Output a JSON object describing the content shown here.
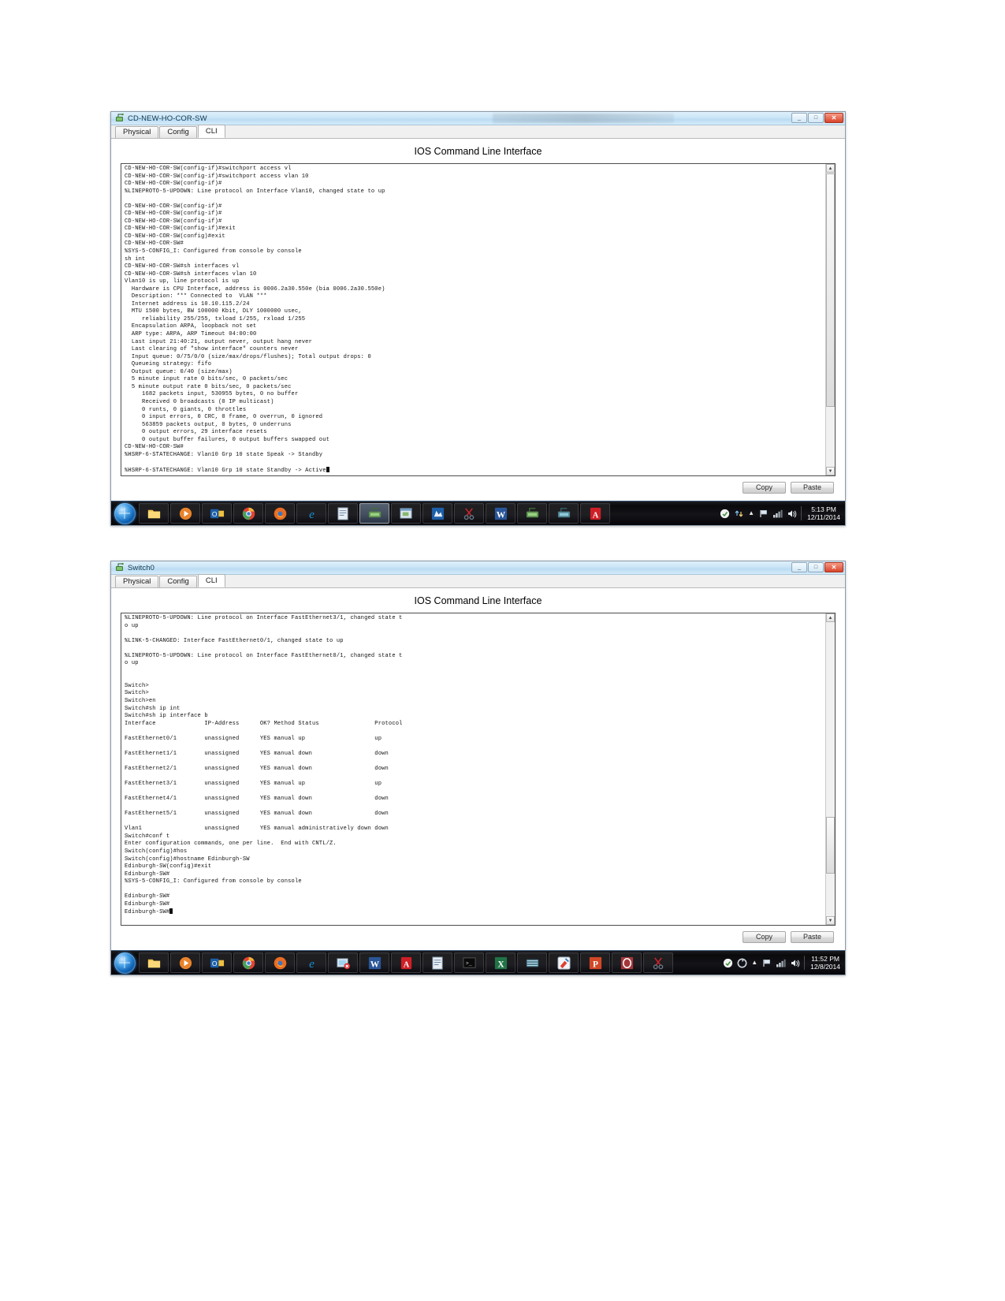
{
  "colors": {
    "titlebar_accent": "#bcdcf3",
    "close_button": "#d8442a",
    "terminal_text": "#121212",
    "taskbar": "#0a0a0c"
  },
  "windows": [
    {
      "title": "CD-NEW-HO-COR-SW",
      "icon": "packet-tracer-device-icon",
      "tabs": [
        {
          "label": "Physical",
          "active": false
        },
        {
          "label": "Config",
          "active": false
        },
        {
          "label": "CLI",
          "active": true
        }
      ],
      "panel_heading": "IOS Command Line Interface",
      "window_buttons": {
        "minimize": "_",
        "maximize": "□",
        "close": "✕"
      },
      "terminal_text": "CD-NEW-HO-COR-SW(config-if)#switchport access vl\nCD-NEW-HO-COR-SW(config-if)#switchport access vlan 10\nCD-NEW-HO-COR-SW(config-if)#\n%LINEPROTO-5-UPDOWN: Line protocol on Interface Vlan10, changed state to up\n\nCD-NEW-HO-COR-SW(config-if)#\nCD-NEW-HO-COR-SW(config-if)#\nCD-NEW-HO-COR-SW(config-if)#\nCD-NEW-HO-COR-SW(config-if)#exit\nCD-NEW-HO-COR-SW(config)#exit\nCD-NEW-HO-COR-SW#\n%SYS-5-CONFIG_I: Configured from console by console\nsh int\nCD-NEW-HO-COR-SW#sh interfaces vl\nCD-NEW-HO-COR-SW#sh interfaces vlan 10\nVlan10 is up, line protocol is up\n  Hardware is CPU Interface, address is 0006.2a30.550e (bia 0006.2a30.550e)\n  Description: *** Connected to  VLAN ***\n  Internet address is 10.10.115.2/24\n  MTU 1500 bytes, BW 100000 Kbit, DLY 1000000 usec,\n     reliability 255/255, txload 1/255, rxload 1/255\n  Encapsulation ARPA, loopback not set\n  ARP type: ARPA, ARP Timeout 04:00:00\n  Last input 21:40:21, output never, output hang never\n  Last clearing of \"show interface\" counters never\n  Input queue: 0/75/0/0 (size/max/drops/flushes); Total output drops: 0\n  Queueing strategy: fifo\n  Output queue: 0/40 (size/max)\n  5 minute input rate 0 bits/sec, 0 packets/sec\n  5 minute output rate 0 bits/sec, 0 packets/sec\n     1682 packets input, 530955 bytes, 0 no buffer\n     Received 0 broadcasts (0 IP multicast)\n     0 runts, 0 giants, 0 throttles\n     0 input errors, 0 CRC, 0 frame, 0 overrun, 0 ignored\n     563859 packets output, 0 bytes, 0 underruns\n     0 output errors, 29 interface resets\n     0 output buffer failures, 0 output buffers swapped out\nCD-NEW-HO-COR-SW#\n%HSRP-6-STATECHANGE: Vlan10 Grp 10 state Speak -> Standby\n\n%HSRP-6-STATECHANGE: Vlan10 Grp 10 state Standby -> Active",
      "buttons": [
        {
          "label": "Copy",
          "name": "copy-button"
        },
        {
          "label": "Paste",
          "name": "paste-button"
        }
      ],
      "taskbar": {
        "clock_time": "5:13 PM",
        "clock_date": "12/11/2014",
        "tray_arrow": "▲",
        "items": [
          "windows-explorer-icon",
          "media-player-icon",
          "outlook-icon",
          "chrome-icon",
          "firefox-icon",
          "internet-explorer-icon",
          "notepad-icon",
          "packet-tracer-icon",
          "packet-tracer-window-icon",
          "visio-icon",
          "snipping-tool-icon",
          "word-icon",
          "packet-tracer-alt-icon",
          "packet-tracer-alt2-icon",
          "acrobat-reader-icon"
        ]
      }
    },
    {
      "title": "Switch0",
      "icon": "packet-tracer-device-icon",
      "tabs": [
        {
          "label": "Physical",
          "active": false
        },
        {
          "label": "Config",
          "active": false
        },
        {
          "label": "CLI",
          "active": true
        }
      ],
      "panel_heading": "IOS Command Line Interface",
      "window_buttons": {
        "minimize": "_",
        "maximize": "□",
        "close": "✕"
      },
      "terminal_text": "%LINEPROTO-5-UPDOWN: Line protocol on Interface FastEthernet3/1, changed state t\no up\n\n%LINK-5-CHANGED: Interface FastEthernet0/1, changed state to up\n\n%LINEPROTO-5-UPDOWN: Line protocol on Interface FastEthernet0/1, changed state t\no up\n\n\nSwitch>\nSwitch>\nSwitch>en\nSwitch#sh ip int\nSwitch#sh ip interface b\nInterface              IP-Address      OK? Method Status                Protocol\n\nFastEthernet0/1        unassigned      YES manual up                    up\n\nFastEthernet1/1        unassigned      YES manual down                  down\n\nFastEthernet2/1        unassigned      YES manual down                  down\n\nFastEthernet3/1        unassigned      YES manual up                    up\n\nFastEthernet4/1        unassigned      YES manual down                  down\n\nFastEthernet5/1        unassigned      YES manual down                  down\n\nVlan1                  unassigned      YES manual administratively down down\nSwitch#conf t\nEnter configuration commands, one per line.  End with CNTL/Z.\nSwitch(config)#hos\nSwitch(config)#hostname Edinburgh-SW\nEdinburgh-SW(config)#exit\nEdinburgh-SW#\n%SYS-5-CONFIG_I: Configured from console by console\n\nEdinburgh-SW#\nEdinburgh-SW#\nEdinburgh-SW#",
      "buttons": [
        {
          "label": "Copy",
          "name": "copy-button"
        },
        {
          "label": "Paste",
          "name": "paste-button"
        }
      ],
      "taskbar": {
        "clock_time": "11:52 PM",
        "clock_date": "12/8/2014",
        "tray_arrow": "▲",
        "items": [
          "windows-explorer-icon",
          "media-player-icon",
          "outlook-icon",
          "chrome-icon",
          "firefox-icon",
          "internet-explorer-icon",
          "packet-tracer-icon",
          "word-icon",
          "acrobat-reader-icon",
          "notepad-icon",
          "command-prompt-icon",
          "excel-icon",
          "packet-tracer-alt-icon",
          "paint-icon",
          "powerpoint-icon",
          "access-icon",
          "snipping-tool-icon"
        ]
      }
    }
  ]
}
